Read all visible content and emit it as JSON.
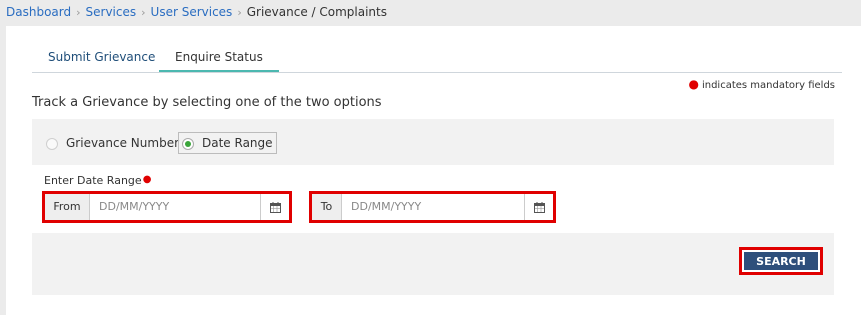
{
  "breadcrumb": {
    "items": [
      "Dashboard",
      "Services",
      "User Services"
    ],
    "current": "Grievance / Complaints",
    "separator": "›"
  },
  "tabs": [
    {
      "label": "Submit Grievance",
      "active": false
    },
    {
      "label": "Enquire Status",
      "active": true
    }
  ],
  "mandatory_note": "indicates mandatory fields",
  "title": "Track a Grievance by selecting one of the two options",
  "options": [
    {
      "label": "Grievance Number",
      "selected": false
    },
    {
      "label": "Date Range",
      "selected": true
    }
  ],
  "date_range": {
    "label": "Enter Date Range",
    "from": {
      "addon": "From",
      "placeholder": "DD/MM/YYYY",
      "value": ""
    },
    "to": {
      "addon": "To",
      "placeholder": "DD/MM/YYYY",
      "value": ""
    }
  },
  "search_label": "SEARCH",
  "colors": {
    "link": "#2a6dc1",
    "required": "#e00000",
    "highlight": "#e00000",
    "tab_accent": "#4cb8b0",
    "button": "#2e4f7b",
    "radio_selected": "#3aa53a"
  },
  "icons": {
    "calendar": "calendar-icon",
    "separator": "chevron-right-icon"
  }
}
